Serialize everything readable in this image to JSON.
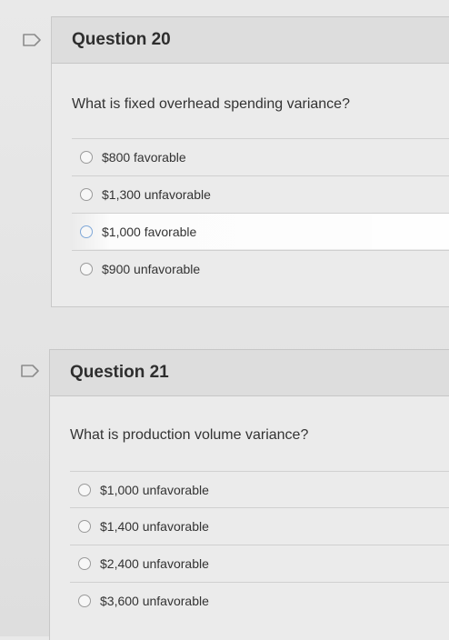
{
  "questions": [
    {
      "title": "Question 20",
      "text": "What is fixed overhead spending variance?",
      "options": [
        {
          "label": "$800 favorable"
        },
        {
          "label": "$1,300 unfavorable"
        },
        {
          "label": "$1,000 favorable"
        },
        {
          "label": "$900 unfavorable"
        }
      ]
    },
    {
      "title": "Question 21",
      "text": "What is production volume variance?",
      "options": [
        {
          "label": "$1,000 unfavorable"
        },
        {
          "label": "$1,400 unfavorable"
        },
        {
          "label": "$2,400 unfavorable"
        },
        {
          "label": "$3,600 unfavorable"
        }
      ]
    }
  ],
  "icons": {
    "flag": "flag-outline-icon",
    "radio": "radio-unselected-icon"
  },
  "colors": {
    "header_bg": "#dddddd",
    "body_bg": "#ebebeb",
    "highlight": "#ffffff"
  }
}
